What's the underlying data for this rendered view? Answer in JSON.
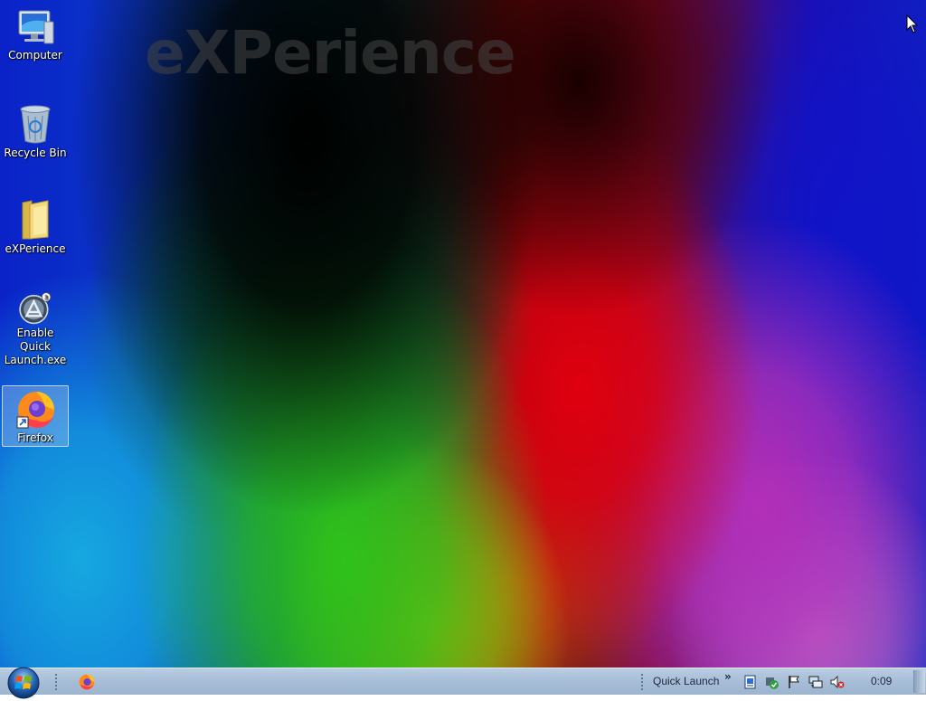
{
  "desktop": {
    "watermark": "eXPerience",
    "icons": [
      {
        "label": "Computer",
        "icon": "computer-icon"
      },
      {
        "label": "Recycle Bin",
        "icon": "recycle-bin-icon"
      },
      {
        "label": "eXPerience",
        "icon": "folder-icon"
      },
      {
        "label": "Enable Quick Launch.exe",
        "icon": "app-launcher-icon"
      },
      {
        "label": "Firefox",
        "icon": "firefox-icon",
        "selected": true
      }
    ]
  },
  "taskbar": {
    "start_icon": "windows-orb-icon",
    "pinned": [
      {
        "icon": "firefox-icon"
      }
    ],
    "quick_launch_label": "Quick Launch",
    "quick_launch_chevron": "»",
    "tray_icons": [
      "document-icon",
      "security-shield-icon",
      "flag-icon",
      "network-icon",
      "volume-muted-icon"
    ],
    "clock": "0:09"
  },
  "colors": {
    "taskbar_top": "#b9cde3",
    "taskbar_bottom": "#9db4cf",
    "selection": "#b4c8f0"
  }
}
